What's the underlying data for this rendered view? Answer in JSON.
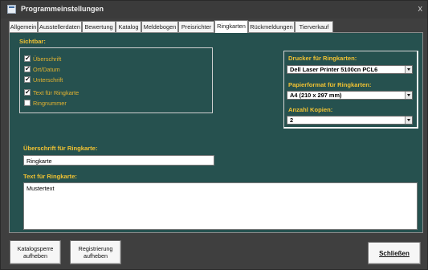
{
  "window": {
    "title": "Programmeinstellungen",
    "close_glyph": "x"
  },
  "tabs": [
    {
      "label": "Allgemein"
    },
    {
      "label": "Ausstellerdaten"
    },
    {
      "label": "Bewertung"
    },
    {
      "label": "Katalog"
    },
    {
      "label": "Meldebogen"
    },
    {
      "label": "Preisrichter"
    },
    {
      "label": "Ringkarten"
    },
    {
      "label": "Rückmeldungen"
    },
    {
      "label": "Tierverkauf"
    }
  ],
  "active_tab": "Ringkarten",
  "sichtbar": {
    "heading": "Sichtbar:",
    "items": [
      {
        "label": "Überschrift",
        "checked": true
      },
      {
        "label": "Ort/Datum",
        "checked": true
      },
      {
        "label": "Unterschrift",
        "checked": true
      },
      {
        "label": "Text für Ringkarte",
        "checked": true
      },
      {
        "label": "Ringnummer",
        "checked": false
      }
    ]
  },
  "drucker": {
    "label": "Drucker für Ringkarten:",
    "value": "Dell Laser Printer 5100cn PCL6"
  },
  "papierformat": {
    "label": "Papierformat für Ringkarten:",
    "value": "A4 (210 x 297 mm)"
  },
  "kopien": {
    "label": "Anzahl Kopien:",
    "value": "2"
  },
  "ueberschrift": {
    "label": "Überschrift für Ringkarte:",
    "value": "Ringkarte"
  },
  "text": {
    "label": "Text für Ringkarte:",
    "value": "Mustertext"
  },
  "buttons": {
    "katalogsperre_line1": "Katalogsperre",
    "katalogsperre_line2": "aufheben",
    "registrierung_line1": "Registrierung",
    "registrierung_line2": "aufheben",
    "schliessen": "Schließen"
  },
  "colors": {
    "panel": "#26514f",
    "label": "#f1c232",
    "window": "#3f3f3f"
  }
}
